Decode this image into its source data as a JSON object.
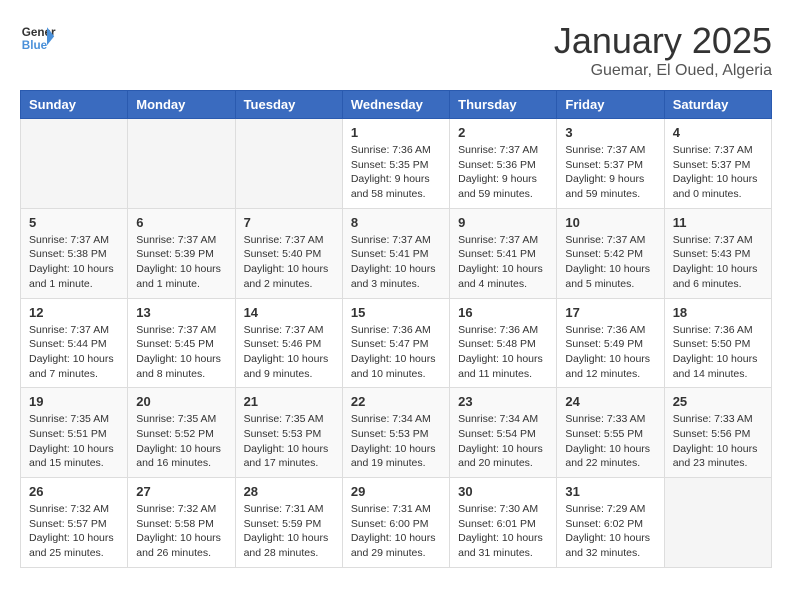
{
  "logo": {
    "line1": "General",
    "line2": "Blue"
  },
  "title": "January 2025",
  "subtitle": "Guemar, El Oued, Algeria",
  "days_of_week": [
    "Sunday",
    "Monday",
    "Tuesday",
    "Wednesday",
    "Thursday",
    "Friday",
    "Saturday"
  ],
  "weeks": [
    [
      {
        "day": "",
        "info": ""
      },
      {
        "day": "",
        "info": ""
      },
      {
        "day": "",
        "info": ""
      },
      {
        "day": "1",
        "info": "Sunrise: 7:36 AM\nSunset: 5:35 PM\nDaylight: 9 hours\nand 58 minutes."
      },
      {
        "day": "2",
        "info": "Sunrise: 7:37 AM\nSunset: 5:36 PM\nDaylight: 9 hours\nand 59 minutes."
      },
      {
        "day": "3",
        "info": "Sunrise: 7:37 AM\nSunset: 5:37 PM\nDaylight: 9 hours\nand 59 minutes."
      },
      {
        "day": "4",
        "info": "Sunrise: 7:37 AM\nSunset: 5:37 PM\nDaylight: 10 hours\nand 0 minutes."
      }
    ],
    [
      {
        "day": "5",
        "info": "Sunrise: 7:37 AM\nSunset: 5:38 PM\nDaylight: 10 hours\nand 1 minute."
      },
      {
        "day": "6",
        "info": "Sunrise: 7:37 AM\nSunset: 5:39 PM\nDaylight: 10 hours\nand 1 minute."
      },
      {
        "day": "7",
        "info": "Sunrise: 7:37 AM\nSunset: 5:40 PM\nDaylight: 10 hours\nand 2 minutes."
      },
      {
        "day": "8",
        "info": "Sunrise: 7:37 AM\nSunset: 5:41 PM\nDaylight: 10 hours\nand 3 minutes."
      },
      {
        "day": "9",
        "info": "Sunrise: 7:37 AM\nSunset: 5:41 PM\nDaylight: 10 hours\nand 4 minutes."
      },
      {
        "day": "10",
        "info": "Sunrise: 7:37 AM\nSunset: 5:42 PM\nDaylight: 10 hours\nand 5 minutes."
      },
      {
        "day": "11",
        "info": "Sunrise: 7:37 AM\nSunset: 5:43 PM\nDaylight: 10 hours\nand 6 minutes."
      }
    ],
    [
      {
        "day": "12",
        "info": "Sunrise: 7:37 AM\nSunset: 5:44 PM\nDaylight: 10 hours\nand 7 minutes."
      },
      {
        "day": "13",
        "info": "Sunrise: 7:37 AM\nSunset: 5:45 PM\nDaylight: 10 hours\nand 8 minutes."
      },
      {
        "day": "14",
        "info": "Sunrise: 7:37 AM\nSunset: 5:46 PM\nDaylight: 10 hours\nand 9 minutes."
      },
      {
        "day": "15",
        "info": "Sunrise: 7:36 AM\nSunset: 5:47 PM\nDaylight: 10 hours\nand 10 minutes."
      },
      {
        "day": "16",
        "info": "Sunrise: 7:36 AM\nSunset: 5:48 PM\nDaylight: 10 hours\nand 11 minutes."
      },
      {
        "day": "17",
        "info": "Sunrise: 7:36 AM\nSunset: 5:49 PM\nDaylight: 10 hours\nand 12 minutes."
      },
      {
        "day": "18",
        "info": "Sunrise: 7:36 AM\nSunset: 5:50 PM\nDaylight: 10 hours\nand 14 minutes."
      }
    ],
    [
      {
        "day": "19",
        "info": "Sunrise: 7:35 AM\nSunset: 5:51 PM\nDaylight: 10 hours\nand 15 minutes."
      },
      {
        "day": "20",
        "info": "Sunrise: 7:35 AM\nSunset: 5:52 PM\nDaylight: 10 hours\nand 16 minutes."
      },
      {
        "day": "21",
        "info": "Sunrise: 7:35 AM\nSunset: 5:53 PM\nDaylight: 10 hours\nand 17 minutes."
      },
      {
        "day": "22",
        "info": "Sunrise: 7:34 AM\nSunset: 5:53 PM\nDaylight: 10 hours\nand 19 minutes."
      },
      {
        "day": "23",
        "info": "Sunrise: 7:34 AM\nSunset: 5:54 PM\nDaylight: 10 hours\nand 20 minutes."
      },
      {
        "day": "24",
        "info": "Sunrise: 7:33 AM\nSunset: 5:55 PM\nDaylight: 10 hours\nand 22 minutes."
      },
      {
        "day": "25",
        "info": "Sunrise: 7:33 AM\nSunset: 5:56 PM\nDaylight: 10 hours\nand 23 minutes."
      }
    ],
    [
      {
        "day": "26",
        "info": "Sunrise: 7:32 AM\nSunset: 5:57 PM\nDaylight: 10 hours\nand 25 minutes."
      },
      {
        "day": "27",
        "info": "Sunrise: 7:32 AM\nSunset: 5:58 PM\nDaylight: 10 hours\nand 26 minutes."
      },
      {
        "day": "28",
        "info": "Sunrise: 7:31 AM\nSunset: 5:59 PM\nDaylight: 10 hours\nand 28 minutes."
      },
      {
        "day": "29",
        "info": "Sunrise: 7:31 AM\nSunset: 6:00 PM\nDaylight: 10 hours\nand 29 minutes."
      },
      {
        "day": "30",
        "info": "Sunrise: 7:30 AM\nSunset: 6:01 PM\nDaylight: 10 hours\nand 31 minutes."
      },
      {
        "day": "31",
        "info": "Sunrise: 7:29 AM\nSunset: 6:02 PM\nDaylight: 10 hours\nand 32 minutes."
      },
      {
        "day": "",
        "info": ""
      }
    ]
  ]
}
